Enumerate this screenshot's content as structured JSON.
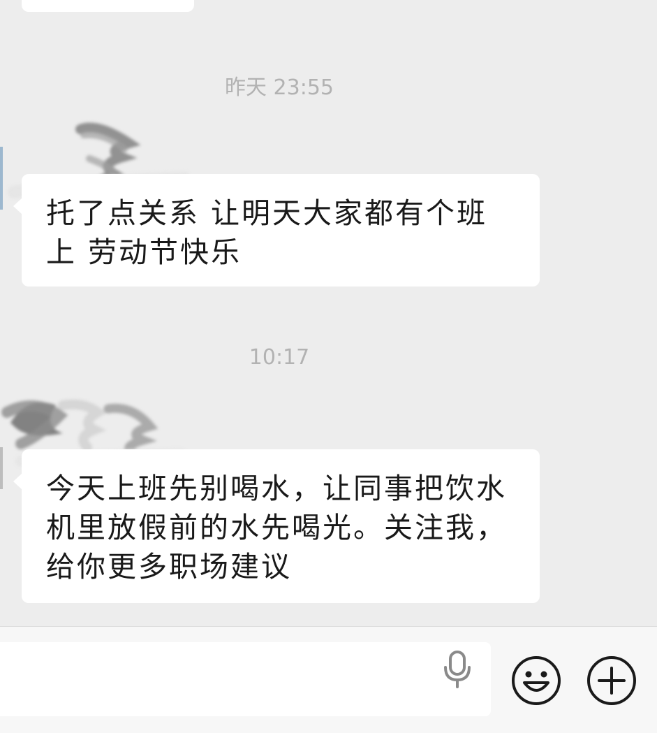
{
  "chat": {
    "messages": [
      {
        "timestamp": "昨天 23:55",
        "line1": "托了点关系 让明天大家都有个班",
        "line2": "上  劳动节快乐"
      },
      {
        "timestamp": "10:17",
        "line1": "今天上班先别喝水，让同事把饮水",
        "line2": "机里放假前的水先喝光。关注我，",
        "line3": "给你更多职场建议"
      }
    ]
  },
  "input_bar": {
    "text_value": "",
    "icons": [
      "mic-icon",
      "emoji-icon",
      "plus-icon"
    ]
  },
  "colors": {
    "background": "#ededed",
    "bubble": "#ffffff",
    "timestamp": "#b2b2b2",
    "text": "#191919"
  }
}
